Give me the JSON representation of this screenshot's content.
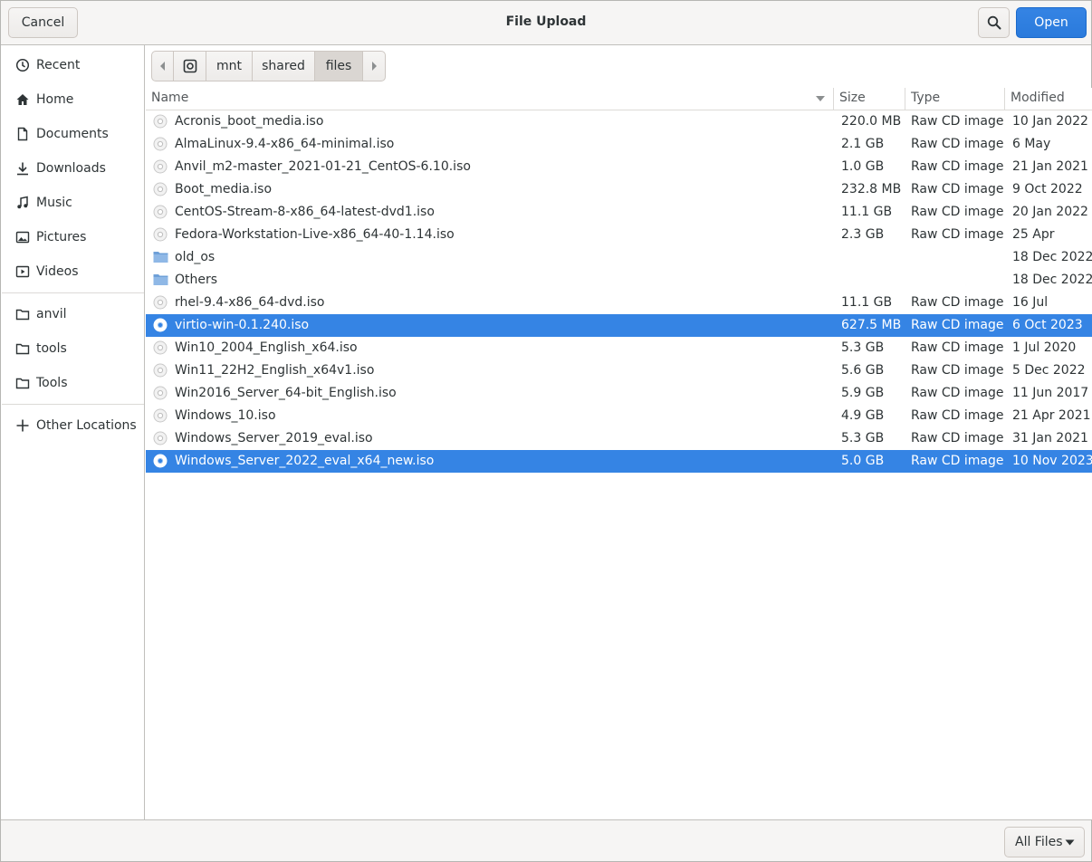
{
  "header": {
    "title": "File Upload",
    "cancel_label": "Cancel",
    "open_label": "Open",
    "search_icon": "search-icon"
  },
  "sidebar": {
    "items": [
      {
        "label": "Recent",
        "icon": "clock-icon"
      },
      {
        "label": "Home",
        "icon": "home-icon"
      },
      {
        "label": "Documents",
        "icon": "document-icon"
      },
      {
        "label": "Downloads",
        "icon": "download-icon"
      },
      {
        "label": "Music",
        "icon": "music-icon"
      },
      {
        "label": "Pictures",
        "icon": "picture-icon"
      },
      {
        "label": "Videos",
        "icon": "video-icon"
      },
      {
        "label": "anvil",
        "icon": "folder-icon"
      },
      {
        "label": "tools",
        "icon": "folder-icon"
      },
      {
        "label": "Tools",
        "icon": "folder-icon"
      },
      {
        "label": "Other Locations",
        "icon": "plus-icon"
      }
    ]
  },
  "pathbar": {
    "segments": [
      "mnt",
      "shared",
      "files"
    ],
    "active": "files"
  },
  "columns": {
    "name": "Name",
    "size": "Size",
    "type": "Type",
    "modified": "Modified"
  },
  "files": [
    {
      "name": "Acronis_boot_media.iso",
      "size": "220.0 MB",
      "type": "Raw CD image",
      "modified": "10 Jan 2022",
      "kind": "disc"
    },
    {
      "name": "AlmaLinux-9.4-x86_64-minimal.iso",
      "size": "2.1 GB",
      "type": "Raw CD image",
      "modified": "6 May",
      "kind": "disc"
    },
    {
      "name": "Anvil_m2-master_2021-01-21_CentOS-6.10.iso",
      "size": "1.0 GB",
      "type": "Raw CD image",
      "modified": "21 Jan 2021",
      "kind": "disc"
    },
    {
      "name": "Boot_media.iso",
      "size": "232.8 MB",
      "type": "Raw CD image",
      "modified": "9 Oct 2022",
      "kind": "disc"
    },
    {
      "name": "CentOS-Stream-8-x86_64-latest-dvd1.iso",
      "size": "11.1 GB",
      "type": "Raw CD image",
      "modified": "20 Jan 2022",
      "kind": "disc"
    },
    {
      "name": "Fedora-Workstation-Live-x86_64-40-1.14.iso",
      "size": "2.3 GB",
      "type": "Raw CD image",
      "modified": "25 Apr",
      "kind": "disc"
    },
    {
      "name": "old_os",
      "size": "",
      "type": "",
      "modified": "18 Dec 2022",
      "kind": "folder"
    },
    {
      "name": "Others",
      "size": "",
      "type": "",
      "modified": "18 Dec 2022",
      "kind": "folder"
    },
    {
      "name": "rhel-9.4-x86_64-dvd.iso",
      "size": "11.1 GB",
      "type": "Raw CD image",
      "modified": "16 Jul",
      "kind": "disc"
    },
    {
      "name": "virtio-win-0.1.240.iso",
      "size": "627.5 MB",
      "type": "Raw CD image",
      "modified": "6 Oct 2023",
      "kind": "disc",
      "selected": true
    },
    {
      "name": "Win10_2004_English_x64.iso",
      "size": "5.3 GB",
      "type": "Raw CD image",
      "modified": "1 Jul 2020",
      "kind": "disc"
    },
    {
      "name": "Win11_22H2_English_x64v1.iso",
      "size": "5.6 GB",
      "type": "Raw CD image",
      "modified": "5 Dec 2022",
      "kind": "disc"
    },
    {
      "name": "Win2016_Server_64-bit_English.iso",
      "size": "5.9 GB",
      "type": "Raw CD image",
      "modified": "11 Jun 2017",
      "kind": "disc"
    },
    {
      "name": "Windows_10.iso",
      "size": "4.9 GB",
      "type": "Raw CD image",
      "modified": "21 Apr 2021",
      "kind": "disc"
    },
    {
      "name": "Windows_Server_2019_eval.iso",
      "size": "5.3 GB",
      "type": "Raw CD image",
      "modified": "31 Jan 2021",
      "kind": "disc"
    },
    {
      "name": "Windows_Server_2022_eval_x64_new.iso",
      "size": "5.0 GB",
      "type": "Raw CD image",
      "modified": "10 Nov 2023",
      "kind": "disc",
      "selected": true
    }
  ],
  "footer": {
    "filter_label": "All Files"
  },
  "colors": {
    "accent": "#3584e4",
    "folder": "#6ea0d8"
  }
}
